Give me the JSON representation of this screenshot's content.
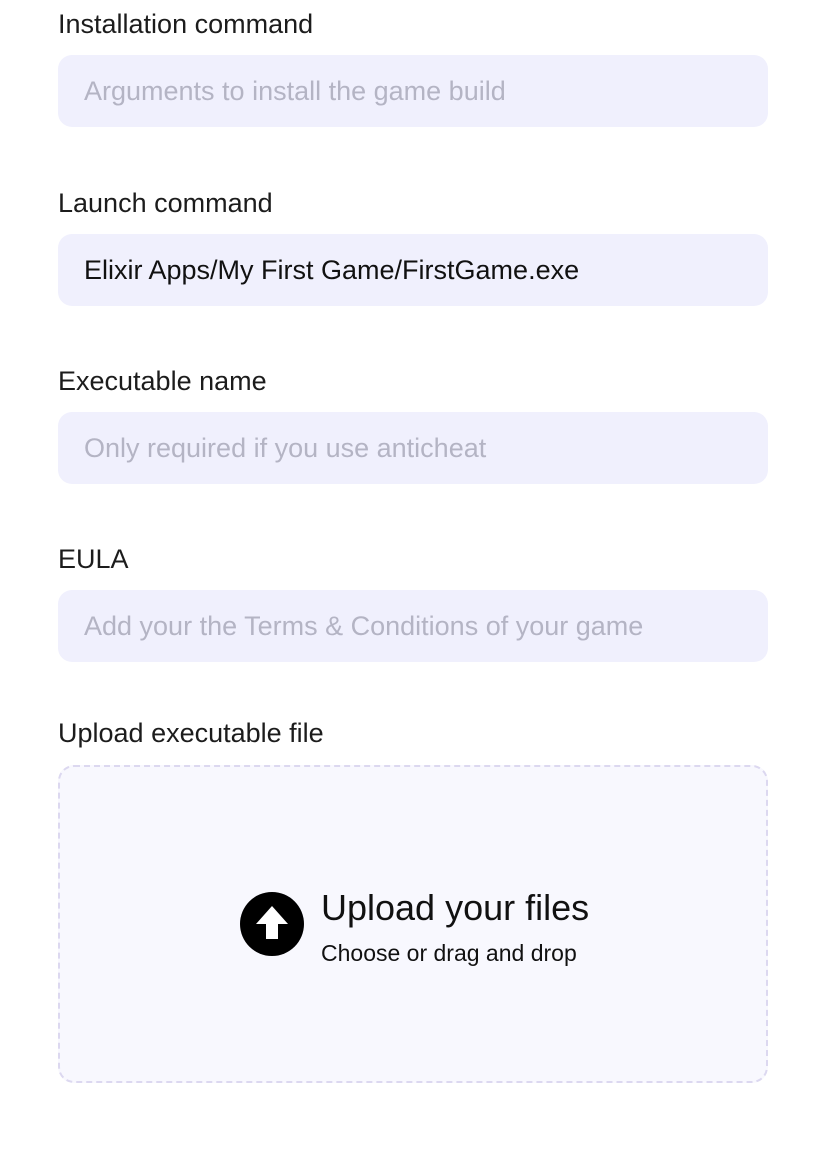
{
  "fields": [
    {
      "label": "Installation command",
      "value": "",
      "placeholder": "Arguments to install the game build"
    },
    {
      "label": "Launch command",
      "value": "Elixir Apps/My First Game/FirstGame.exe",
      "placeholder": ""
    },
    {
      "label": "Executable name",
      "value": "",
      "placeholder": "Only required if you use anticheat"
    },
    {
      "label": "EULA",
      "value": "",
      "placeholder": "Add your the Terms & Conditions of your game"
    }
  ],
  "upload": {
    "label": "Upload executable file",
    "title": "Upload your files",
    "subtitle": "Choose or drag and drop",
    "icon": "arrow-up-circle-icon"
  },
  "colors": {
    "input_bg": "#f0f0fd",
    "placeholder": "#b4b4c4",
    "dropzone_bg": "#f8f8fe",
    "dropzone_border": "#dcd8f0"
  }
}
